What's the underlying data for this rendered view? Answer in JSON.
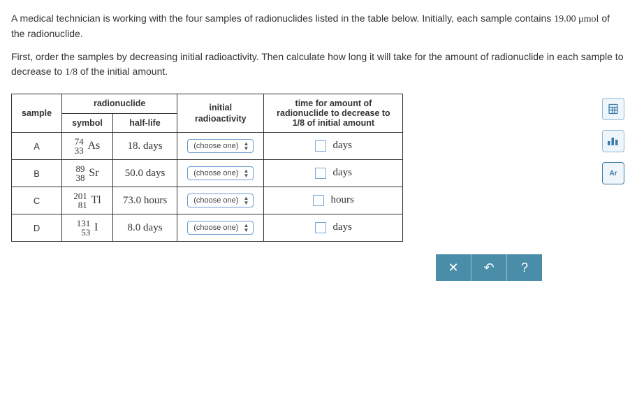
{
  "question": {
    "p1_a": "A medical technician is working with the four samples of radionuclides listed in the table below. Initially, each sample contains ",
    "p1_amt": "19.00 μmol",
    "p1_b": " of the radionuclide.",
    "p2_a": "First, order the samples by decreasing initial radioactivity. Then calculate how long it will take for the amount of radionuclide in each sample to decrease to ",
    "p2_frac": "1/8",
    "p2_b": " of the initial amount."
  },
  "headers": {
    "sample": "sample",
    "radionuclide": "radionuclide",
    "symbol": "symbol",
    "half_life": "half-life",
    "initial_radio": "initial radioactivity",
    "time_col_l1": "time for amount of",
    "time_col_l2": "radionuclide to decrease to",
    "time_col_l3": "1/8 of initial amount"
  },
  "chooser_label": "(choose one)",
  "rows": [
    {
      "sample": "A",
      "mass": "74",
      "z": "33",
      "sym": "As",
      "half_val": "18.",
      "half_unit": "days",
      "ans_unit": "days"
    },
    {
      "sample": "B",
      "mass": "89",
      "z": "38",
      "sym": "Sr",
      "half_val": "50.0",
      "half_unit": "days",
      "ans_unit": "days"
    },
    {
      "sample": "C",
      "mass": "201",
      "z": "81",
      "sym": "Tl",
      "half_val": "73.0",
      "half_unit": "hours",
      "ans_unit": "hours"
    },
    {
      "sample": "D",
      "mass": "131",
      "z": "53",
      "sym": "I",
      "half_val": "8.0",
      "half_unit": "days",
      "ans_unit": "days"
    }
  ],
  "tools": {
    "calc": "calculator",
    "stats": "statistics",
    "periodic": "Ar"
  },
  "actions": {
    "close": "✕",
    "undo": "↶",
    "help": "?"
  }
}
